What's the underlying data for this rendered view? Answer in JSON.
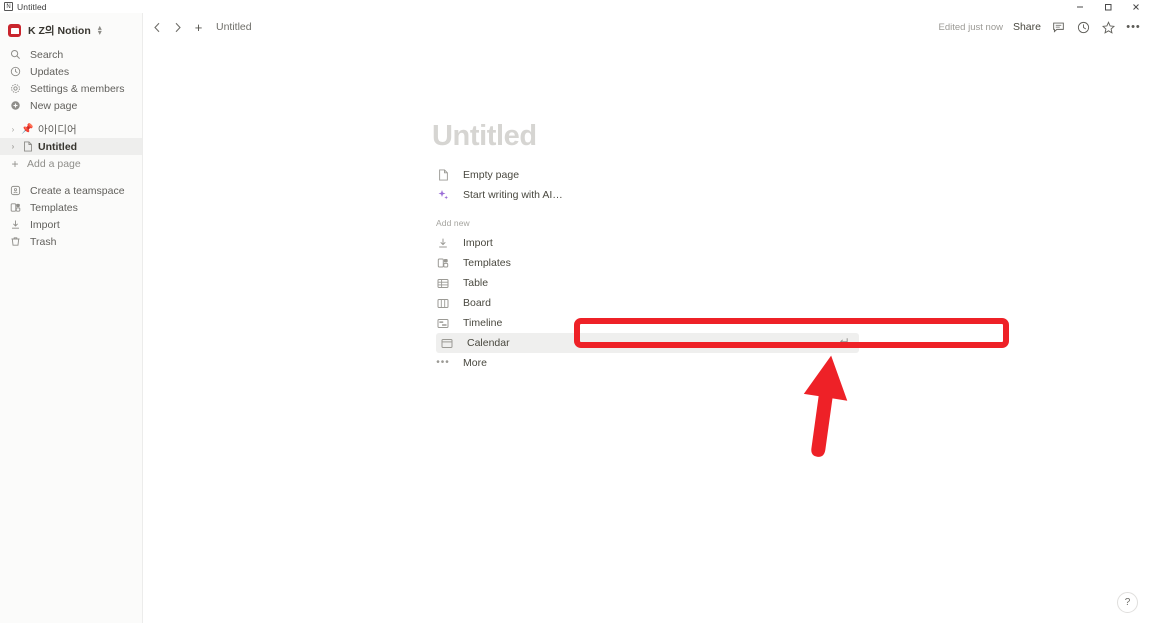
{
  "window": {
    "title": "Untitled",
    "app_icon": "notion-icon",
    "minimize": "–",
    "maximize": "□",
    "close": "✕"
  },
  "sidebar": {
    "workspace": {
      "name": "K Z의 Notion",
      "avatar_color": "#c9252d",
      "switcher_icon": "chevron-updown-icon"
    },
    "nav_items": [
      {
        "label": "Search",
        "icon": "search-icon"
      },
      {
        "label": "Updates",
        "icon": "clock-icon"
      },
      {
        "label": "Settings & members",
        "icon": "gear-icon"
      },
      {
        "label": "New page",
        "icon": "plus-circle-icon"
      }
    ],
    "tree_items": [
      {
        "label": "아이디어",
        "icon": "pushpin-icon",
        "selected": false
      },
      {
        "label": "Untitled",
        "icon": "page-icon",
        "selected": true
      }
    ],
    "add_page": {
      "label": "Add a page",
      "icon": "plus-icon"
    },
    "bottom_items": [
      {
        "label": "Create a teamspace",
        "icon": "teamspace-icon"
      },
      {
        "label": "Templates",
        "icon": "templates-icon"
      },
      {
        "label": "Import",
        "icon": "import-icon"
      },
      {
        "label": "Trash",
        "icon": "trash-icon"
      }
    ]
  },
  "topbar": {
    "back_icon": "chevron-left-icon",
    "forward_icon": "chevron-right-icon",
    "new_icon": "plus-icon",
    "breadcrumb": "Untitled",
    "edited_status": "Edited just now",
    "share_label": "Share",
    "comment_icon": "comment-icon",
    "history_icon": "clock-icon",
    "favorite_icon": "star-icon",
    "more_icon": "ellipsis-icon"
  },
  "page": {
    "title": "Untitled",
    "primary_options": [
      {
        "label": "Empty page",
        "icon": "page-icon"
      },
      {
        "label": "Start writing with AI…",
        "icon": "ai-sparkle-icon"
      }
    ],
    "add_new_label": "Add new",
    "add_new_options": [
      {
        "label": "Import",
        "icon": "import-icon"
      },
      {
        "label": "Templates",
        "icon": "templates-icon"
      },
      {
        "label": "Table",
        "icon": "table-icon"
      },
      {
        "label": "Board",
        "icon": "board-icon"
      },
      {
        "label": "Timeline",
        "icon": "timeline-icon"
      },
      {
        "label": "Calendar",
        "icon": "calendar-icon"
      },
      {
        "label": "More",
        "icon": "ellipsis-icon"
      }
    ],
    "selected_option": "Calendar",
    "enter_hint_icon": "enter-return-icon"
  },
  "annotation": {
    "highlight_color": "#ee2127",
    "highlight_target": "Calendar",
    "arrow_icon": "red-up-arrow"
  },
  "help": {
    "label": "?",
    "icon": "question-mark-icon"
  }
}
